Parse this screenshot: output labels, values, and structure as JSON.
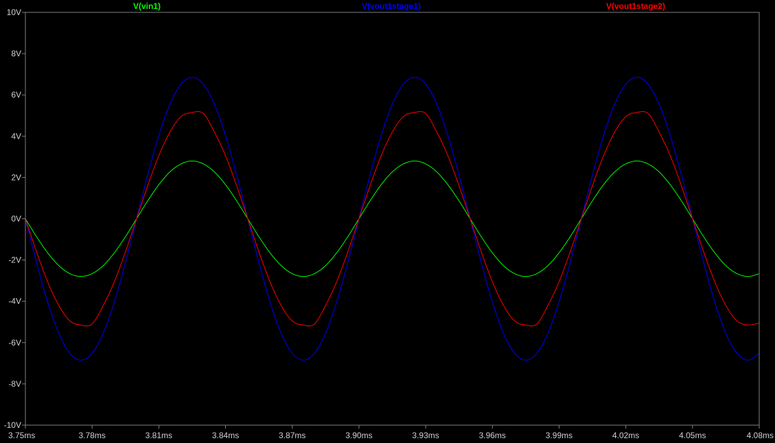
{
  "chart_data": {
    "type": "line",
    "title": "",
    "xlabel": "",
    "ylabel": "",
    "xlim": [
      3.75,
      4.08
    ],
    "ylim": [
      -10,
      10
    ],
    "grid": false,
    "legend": "top",
    "background": "#000000",
    "axis_color": "#808080",
    "x_ticks": [
      3.75,
      3.78,
      3.81,
      3.84,
      3.87,
      3.9,
      3.93,
      3.96,
      3.99,
      4.02,
      4.05,
      4.08
    ],
    "x_tick_labels": [
      "3.75ms",
      "3.78ms",
      "3.81ms",
      "3.84ms",
      "3.87ms",
      "3.90ms",
      "3.93ms",
      "3.96ms",
      "3.99ms",
      "4.02ms",
      "4.05ms",
      "4.08ms"
    ],
    "y_ticks": [
      10,
      8,
      6,
      4,
      2,
      0,
      -2,
      -4,
      -6,
      -8,
      -10
    ],
    "y_tick_labels": [
      "10V",
      "8V",
      "6V",
      "4V",
      "2V",
      "0V",
      "-2V",
      "-4V",
      "-6V",
      "-8V",
      "-10V"
    ],
    "series": [
      {
        "name": "V(vin1)",
        "color": "#00ff00",
        "x": [
          3.75,
          3.755,
          3.76,
          3.765,
          3.77,
          3.775,
          3.78,
          3.785,
          3.79,
          3.795,
          3.8,
          3.805,
          3.81,
          3.815,
          3.82,
          3.825,
          3.83,
          3.835,
          3.84,
          3.845,
          3.85,
          3.855,
          3.86,
          3.865,
          3.87,
          3.875,
          3.88,
          3.885,
          3.89,
          3.895,
          3.9,
          3.905,
          3.91,
          3.915,
          3.92,
          3.925,
          3.93,
          3.935,
          3.94,
          3.945,
          3.95,
          3.955,
          3.96,
          3.965,
          3.97,
          3.975,
          3.98,
          3.985,
          3.99,
          3.995,
          4.0,
          4.005,
          4.01,
          4.015,
          4.02,
          4.025,
          4.03,
          4.035,
          4.04,
          4.045,
          4.05,
          4.055,
          4.06,
          4.065,
          4.07,
          4.075,
          4.08
        ],
        "y": [
          0.0,
          -0.87,
          -1.65,
          -2.27,
          -2.66,
          -2.8,
          -2.66,
          -2.27,
          -1.65,
          -0.87,
          0.0,
          0.87,
          1.65,
          2.27,
          2.66,
          2.8,
          2.66,
          2.27,
          1.65,
          0.87,
          0.0,
          -0.87,
          -1.65,
          -2.27,
          -2.66,
          -2.8,
          -2.66,
          -2.27,
          -1.65,
          -0.87,
          0.0,
          0.87,
          1.65,
          2.27,
          2.66,
          2.8,
          2.66,
          2.27,
          1.65,
          0.87,
          0.0,
          -0.87,
          -1.65,
          -2.27,
          -2.66,
          -2.8,
          -2.66,
          -2.27,
          -1.65,
          -0.87,
          0.0,
          0.87,
          1.65,
          2.27,
          2.66,
          2.8,
          2.66,
          2.27,
          1.65,
          0.87,
          0.0,
          -0.87,
          -1.65,
          -2.27,
          -2.66,
          -2.8,
          -2.66
        ]
      },
      {
        "name": "V(vout1stage1)",
        "color": "#0000ff",
        "x": [
          3.75,
          3.755,
          3.76,
          3.765,
          3.77,
          3.775,
          3.78,
          3.785,
          3.79,
          3.795,
          3.8,
          3.805,
          3.81,
          3.815,
          3.82,
          3.825,
          3.83,
          3.835,
          3.84,
          3.845,
          3.85,
          3.855,
          3.86,
          3.865,
          3.87,
          3.875,
          3.88,
          3.885,
          3.89,
          3.895,
          3.9,
          3.905,
          3.91,
          3.915,
          3.92,
          3.925,
          3.93,
          3.935,
          3.94,
          3.945,
          3.95,
          3.955,
          3.96,
          3.965,
          3.97,
          3.975,
          3.98,
          3.985,
          3.99,
          3.995,
          4.0,
          4.005,
          4.01,
          4.015,
          4.02,
          4.025,
          4.03,
          4.035,
          4.04,
          4.045,
          4.05,
          4.055,
          4.06,
          4.065,
          4.07,
          4.075,
          4.08
        ],
        "y": [
          0.0,
          -2.12,
          -4.03,
          -5.55,
          -6.52,
          -6.85,
          -6.52,
          -5.55,
          -4.03,
          -2.12,
          0.0,
          2.12,
          4.03,
          5.55,
          6.52,
          6.85,
          6.52,
          5.55,
          4.03,
          2.12,
          0.0,
          -2.12,
          -4.03,
          -5.55,
          -6.52,
          -6.85,
          -6.52,
          -5.55,
          -4.03,
          -2.12,
          0.0,
          2.12,
          4.03,
          5.55,
          6.52,
          6.85,
          6.52,
          5.55,
          4.03,
          2.12,
          0.0,
          -2.12,
          -4.03,
          -5.55,
          -6.52,
          -6.85,
          -6.52,
          -5.55,
          -4.03,
          -2.12,
          0.0,
          2.12,
          4.03,
          5.55,
          6.52,
          6.85,
          6.52,
          5.55,
          4.03,
          2.12,
          0.0,
          -2.12,
          -4.03,
          -5.55,
          -6.52,
          -6.85,
          -6.52
        ]
      },
      {
        "name": "V(vout1stage2)",
        "color": "#ff0000",
        "x": [
          3.75,
          3.755,
          3.76,
          3.765,
          3.77,
          3.775,
          3.78,
          3.785,
          3.79,
          3.795,
          3.8,
          3.805,
          3.81,
          3.815,
          3.82,
          3.825,
          3.83,
          3.835,
          3.84,
          3.845,
          3.85,
          3.855,
          3.86,
          3.865,
          3.87,
          3.875,
          3.88,
          3.885,
          3.89,
          3.895,
          3.9,
          3.905,
          3.91,
          3.915,
          3.92,
          3.925,
          3.93,
          3.935,
          3.94,
          3.945,
          3.95,
          3.955,
          3.96,
          3.965,
          3.97,
          3.975,
          3.98,
          3.985,
          3.99,
          3.995,
          4.0,
          4.005,
          4.01,
          4.015,
          4.02,
          4.025,
          4.03,
          4.035,
          4.04,
          4.045,
          4.05,
          4.055,
          4.06,
          4.065,
          4.07,
          4.075,
          4.08
        ],
        "y": [
          0.0,
          -1.6,
          -3.05,
          -4.2,
          -4.95,
          -5.15,
          -5.1,
          -4.2,
          -3.05,
          -1.6,
          0.0,
          1.6,
          3.05,
          4.2,
          4.95,
          5.15,
          5.1,
          4.2,
          3.05,
          1.6,
          0.0,
          -1.6,
          -3.05,
          -4.2,
          -4.95,
          -5.15,
          -5.1,
          -4.2,
          -3.05,
          -1.6,
          0.0,
          1.6,
          3.05,
          4.2,
          4.95,
          5.15,
          5.1,
          4.2,
          3.05,
          1.6,
          0.0,
          -1.6,
          -3.05,
          -4.2,
          -4.95,
          -5.15,
          -5.1,
          -4.2,
          -3.05,
          -1.6,
          0.0,
          1.6,
          3.05,
          4.2,
          4.95,
          5.15,
          5.1,
          4.2,
          3.05,
          1.6,
          0.0,
          -1.6,
          -3.05,
          -4.2,
          -4.95,
          -5.15,
          -5.05
        ]
      }
    ]
  }
}
